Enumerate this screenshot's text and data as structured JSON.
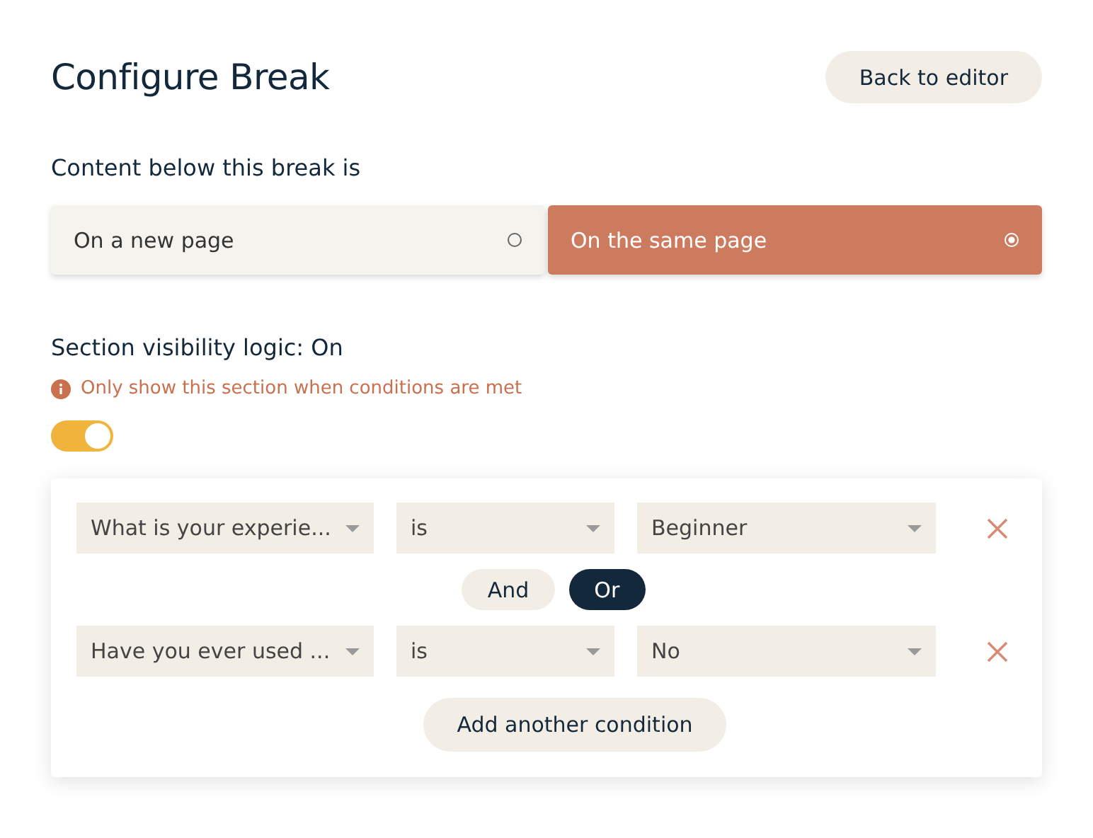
{
  "title": "Configure Break",
  "back_button": "Back to editor",
  "placement": {
    "label": "Content below this break is",
    "options": [
      {
        "label": "On a new page",
        "selected": false
      },
      {
        "label": "On the same page",
        "selected": true
      }
    ]
  },
  "visibility": {
    "label": "Section visibility logic: On",
    "hint": "Only show this section when conditions are met",
    "on": true
  },
  "conditions": [
    {
      "question": "What is your experie...",
      "operator": "is",
      "value": "Beginner"
    },
    {
      "question": "Have you ever used ...",
      "operator": "is",
      "value": "No"
    }
  ],
  "conjunctions": [
    {
      "label": "And",
      "selected": false
    },
    {
      "label": "Or",
      "selected": true
    }
  ],
  "add_button": "Add another condition"
}
